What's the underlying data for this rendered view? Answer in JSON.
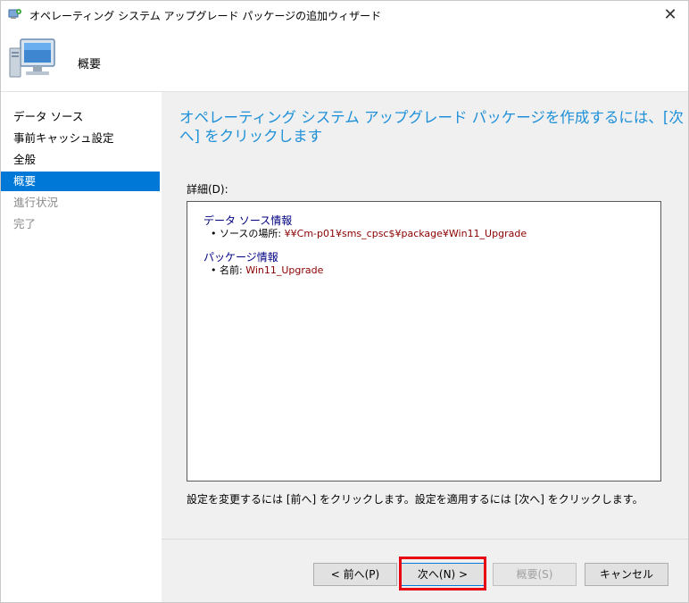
{
  "window": {
    "title": "オペレーティング システム アップグレード パッケージの追加ウィザード",
    "close_glyph": "✕"
  },
  "header": {
    "title": "概要"
  },
  "nav": {
    "items": [
      {
        "label": "データ ソース",
        "state": "normal"
      },
      {
        "label": "事前キャッシュ設定",
        "state": "normal"
      },
      {
        "label": "全般",
        "state": "normal"
      },
      {
        "label": "概要",
        "state": "active"
      },
      {
        "label": "進行状況",
        "state": "dim"
      },
      {
        "label": "完了",
        "state": "dim"
      }
    ]
  },
  "main": {
    "heading": "オペレーティング システム アップグレード パッケージを作成するには、[次へ] をクリックします",
    "detail_label": "詳細(D):",
    "sections": [
      {
        "title": "データ ソース情報",
        "line_label": "• ソースの場所: ",
        "line_value": "¥¥Cm-p01¥sms_cpsc$¥package¥Win11_Upgrade"
      },
      {
        "title": "パッケージ情報",
        "line_label": "• 名前: ",
        "line_value": "Win11_Upgrade"
      }
    ],
    "footer_note": "設定を変更するには [前へ] をクリックします。設定を適用するには [次へ] をクリックします。"
  },
  "buttons": {
    "prev": "< 前へ(P)",
    "next": "次へ(N) >",
    "summary": "概要(S)",
    "cancel": "キャンセル"
  },
  "colors": {
    "accent": "#0078d7",
    "heading": "#1e90d8",
    "highlight": "#e60012"
  },
  "icons": {
    "title": "wizard-app-icon",
    "header": "computer-monitor-icon"
  }
}
